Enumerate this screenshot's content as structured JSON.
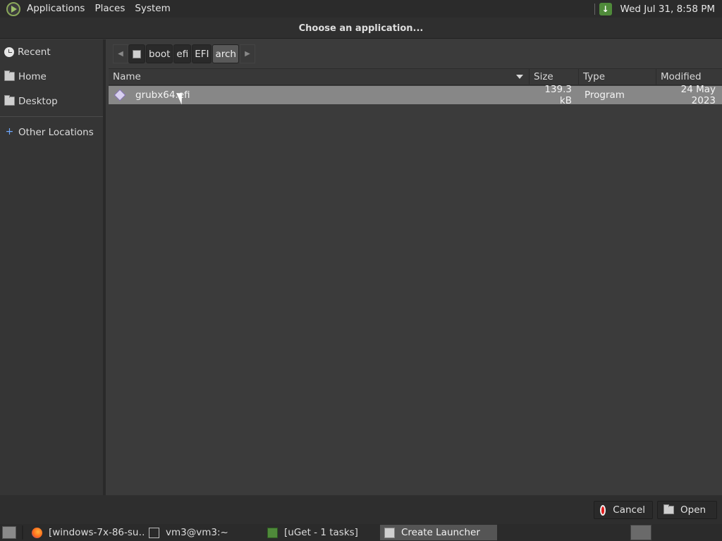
{
  "top_panel": {
    "menus": [
      "Applications",
      "Places",
      "System"
    ],
    "clock": "Wed Jul 31,  8:58 PM"
  },
  "dialog": {
    "title": "Choose an application..."
  },
  "sidebar": {
    "items": [
      {
        "label": "Recent",
        "icon": "recent-icon"
      },
      {
        "label": "Home",
        "icon": "folder-icon"
      },
      {
        "label": "Desktop",
        "icon": "folder-icon"
      },
      {
        "label": "Other Locations",
        "icon": "plus-icon"
      }
    ]
  },
  "pathbar": {
    "crumbs": [
      "boot",
      "efi",
      "EFI",
      "arch"
    ],
    "active": "arch"
  },
  "file_list": {
    "columns": [
      "Name",
      "Size",
      "Type",
      "Modified"
    ],
    "rows": [
      {
        "name": "grubx64.efi",
        "size": "139.3 kB",
        "type": "Program",
        "modified": "24 May 2023"
      }
    ]
  },
  "actions": {
    "cancel_label": "Cancel",
    "open_label": "Open"
  },
  "taskbar": {
    "tasks": [
      {
        "label": "[windows-7x-86-su…",
        "icon": "firefox-icon"
      },
      {
        "label": "vm3@vm3:~",
        "icon": "terminal-icon"
      },
      {
        "label": "[uGet - 1 tasks]",
        "icon": "uget-icon"
      },
      {
        "label": "Create Launcher",
        "icon": "launcher-icon",
        "active": true
      }
    ]
  }
}
